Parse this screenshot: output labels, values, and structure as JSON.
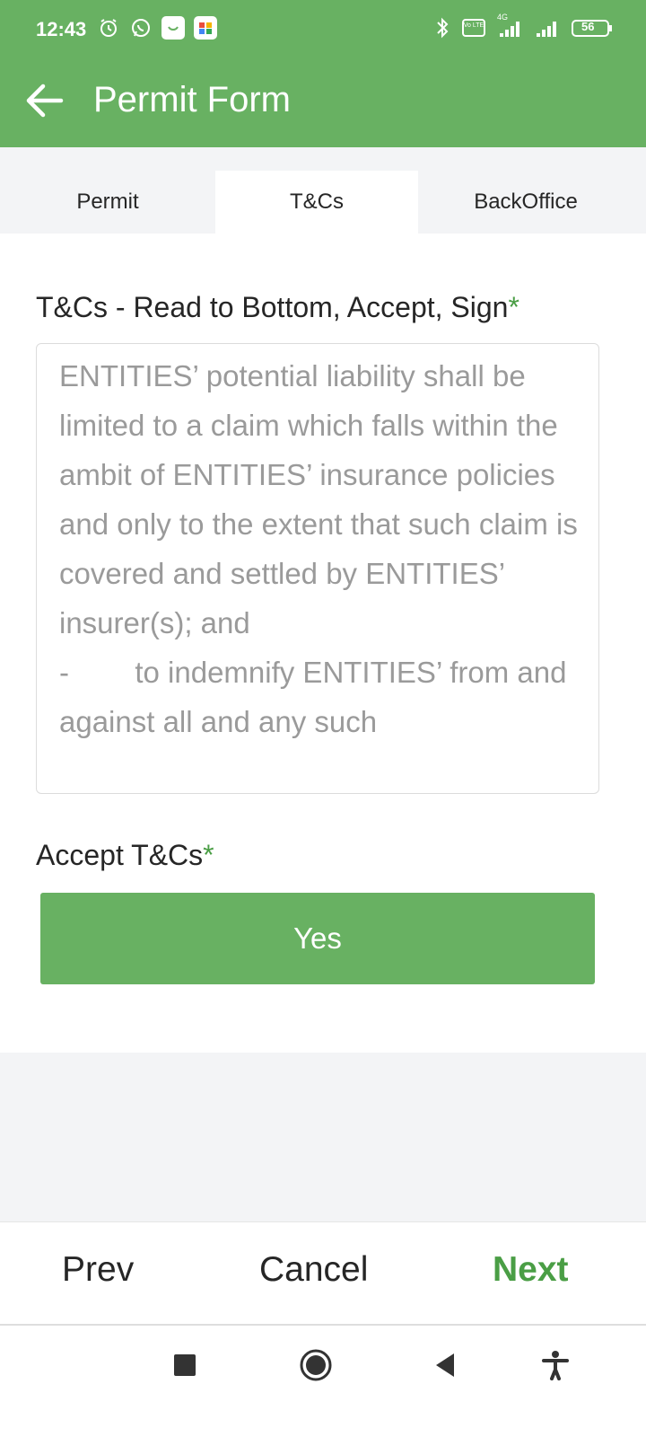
{
  "status_bar": {
    "time": "12:43",
    "battery": "56",
    "left_icons": [
      "alarm-icon",
      "whatsapp-icon",
      "app-icon",
      "app-icon"
    ],
    "right_icons": [
      "bluetooth-icon",
      "volte-icon",
      "signal-icon",
      "signal-icon",
      "battery-icon"
    ],
    "network_label": "4G",
    "volte_label": "Vo LTE"
  },
  "app_bar": {
    "title": "Permit Form",
    "back_icon": "arrow-left-icon"
  },
  "tabs": [
    {
      "label": "Permit",
      "active": false
    },
    {
      "label": "T&Cs",
      "active": true
    },
    {
      "label": "BackOffice",
      "active": false
    }
  ],
  "tc_field": {
    "label": "T&Cs - Read to Bottom, Accept, Sign",
    "required_mark": "*",
    "text": "ENTITIES’ potential liability shall be limited to a claim which falls within the ambit of ENTITIES’ insurance policies and only to the extent that such claim is covered and settled by ENTITIES’ insurer(s); and\n-        to indemnify ENTITIES’ from and against all and any such"
  },
  "accept_field": {
    "label": "Accept T&Cs",
    "required_mark": "*",
    "button_label": "Yes"
  },
  "bottom_nav": {
    "prev": "Prev",
    "cancel": "Cancel",
    "next": "Next"
  },
  "system_nav": [
    "stop-square-icon",
    "home-circle-icon",
    "back-triangle-icon",
    "accessibility-icon"
  ],
  "colors": {
    "primary": "#68b162",
    "accent_text": "#4a9e45",
    "muted_text": "#9a9a9a"
  }
}
